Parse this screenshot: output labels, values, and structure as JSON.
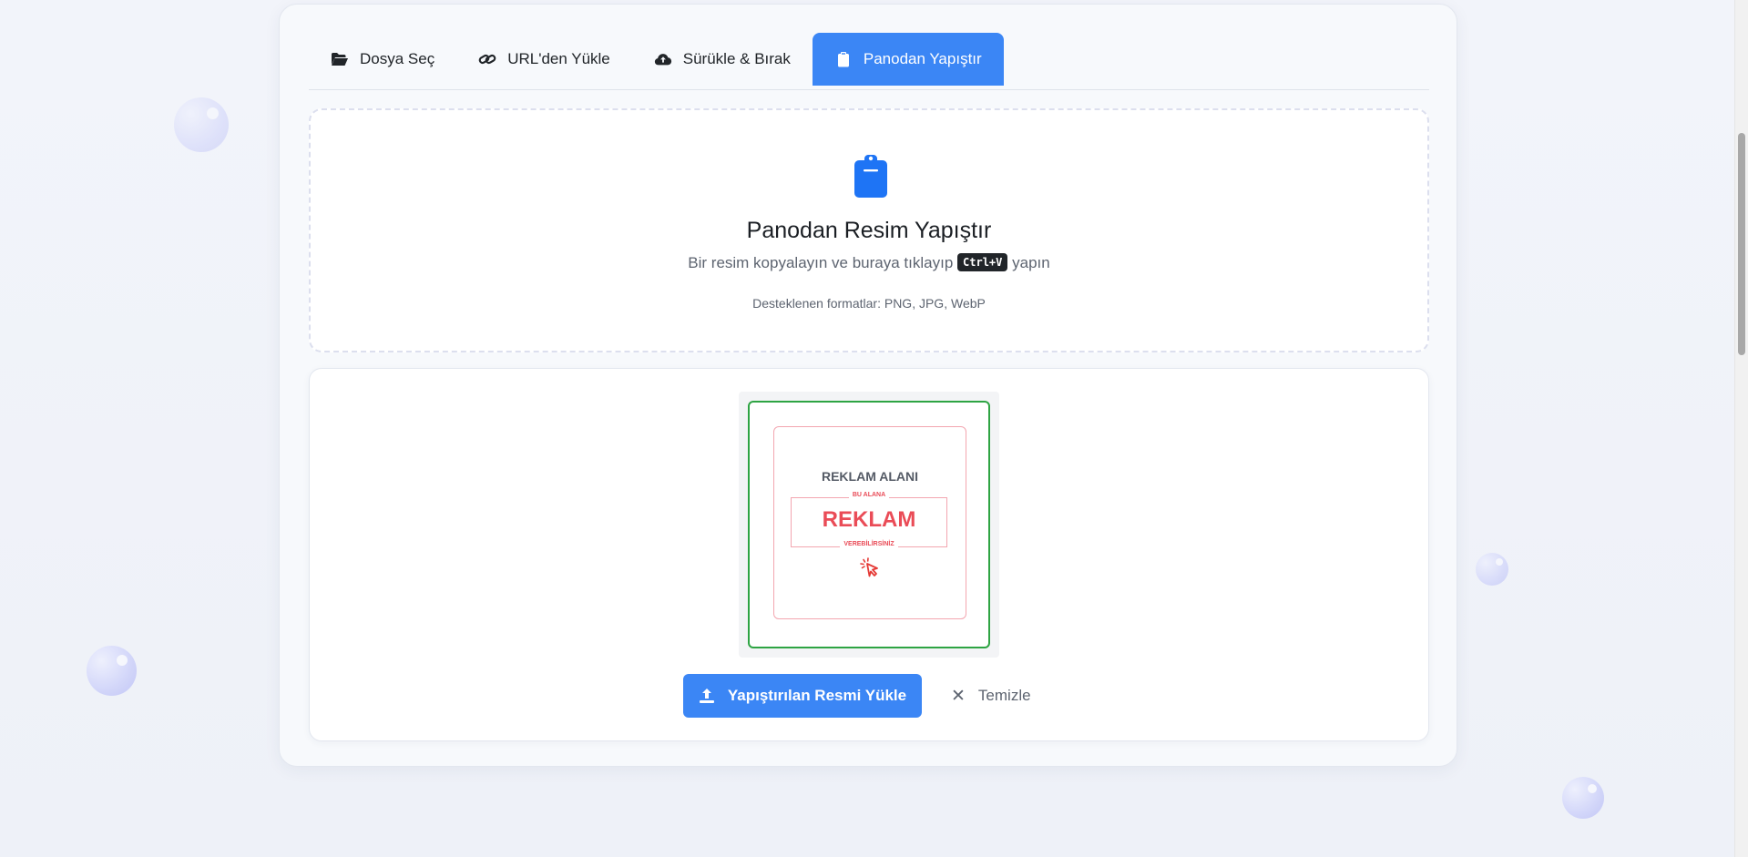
{
  "tabs": [
    {
      "label": "Dosya Seç",
      "icon": "folder-open-icon"
    },
    {
      "label": "URL'den Yükle",
      "icon": "link-icon"
    },
    {
      "label": "Sürükle & Bırak",
      "icon": "cloud-upload-icon"
    },
    {
      "label": "Panodan Yapıştır",
      "icon": "clipboard-icon",
      "active": true
    }
  ],
  "dropzone": {
    "title": "Panodan Resim Yapıştır",
    "subtitle_before": "Bir resim kopyalayın ve buraya tıklayıp",
    "shortcut": "Ctrl+V",
    "subtitle_after": "yapın",
    "formats": "Desteklenen formatlar: PNG, JPG, WebP"
  },
  "preview": {
    "image_title": "REKLAM ALANI",
    "image_small_top": "BU ALANA",
    "image_big": "REKLAM",
    "image_small_bottom": "VEREBİLİRSİNİZ",
    "upload_label": "Yapıştırılan Resmi Yükle",
    "clear_label": "Temizle"
  },
  "colors": {
    "accent": "#3b86f5",
    "success_border": "#2ea443",
    "ad_red": "#ea4c57"
  }
}
